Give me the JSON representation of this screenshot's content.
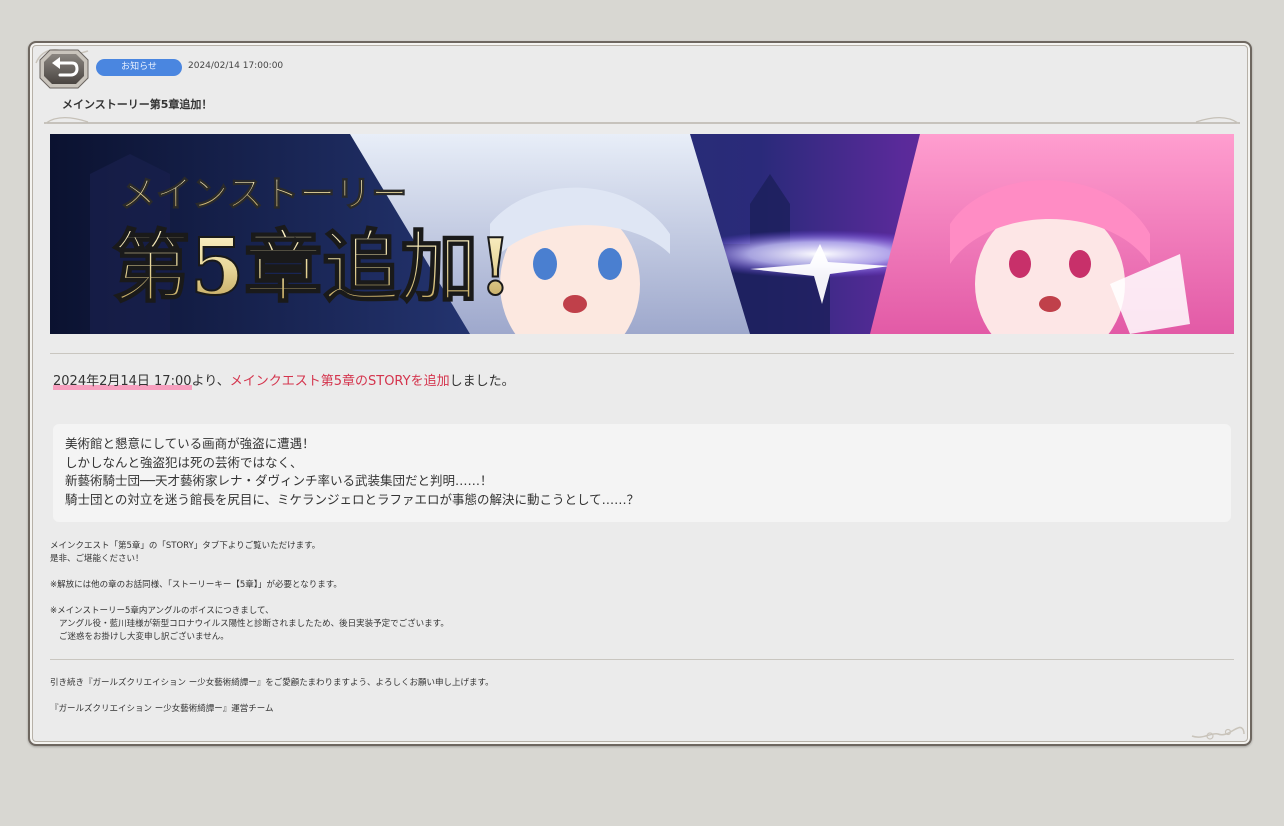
{
  "colors": {
    "background": "#d8d7d2",
    "panel": "#ebebeb",
    "badge": "#4a86e0",
    "highlight_text": "#d4344d",
    "underline": "#f7a0bf"
  },
  "header": {
    "back_icon": "back-arrow-icon",
    "category": "お知らせ",
    "date": "2024/02/14 17:00:00",
    "title": "メインストーリー第5章追加！"
  },
  "banner": {
    "line1": "メインストーリー",
    "line2": "第5章追加!"
  },
  "body": {
    "lead_date": "2024年2月14日 17:00",
    "lead_from": "より、",
    "lead_highlight": "メインクエスト第5章のSTORYを追加",
    "lead_end": "しました。",
    "story_lines": [
      "美術館と懇意にしている画商が強盗に遭遇！",
      "しかしなんと強盗犯は死の芸術ではなく、",
      "新藝術騎士団──天才藝術家レナ・ダヴィンチ率いる武装集団だと判明……！",
      "騎士団との対立を迷う館長を尻目に、ミケランジェロとラファエロが事態の解決に動こうとして……？"
    ],
    "notes": [
      "メインクエスト「第5章」の「STORY」タブ下よりご覧いただけます。",
      "是非、ご堪能ください！",
      "※解放には他の章のお話同様、「ストーリーキー【5章】」が必要となります。",
      "※メインストーリー5章内アングルのボイスにつきまして、",
      "アングル役・藍川珪様が新型コロナウイルス陽性と診断されましたため、後日実装予定でございます。",
      "ご迷惑をお掛けし大変申し訳ございません。"
    ],
    "closing": [
      "引き続き『ガールズクリエイション ー少女藝術綺譚ー』をご愛顧たまわりますよう、よろしくお願い申し上げます。",
      "『ガールズクリエイション ー少女藝術綺譚ー』運営チーム"
    ]
  }
}
